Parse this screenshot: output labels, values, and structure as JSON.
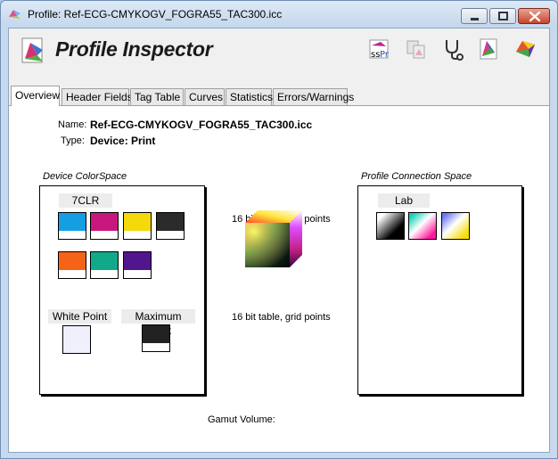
{
  "window": {
    "title": "Profile: Ref-ECG-CMYKOGV_FOGRA55_TAC300.icc"
  },
  "app": {
    "title": "Profile Inspector",
    "toolbar_icons": [
      "profile-compare-icon",
      "profile-copy-icon",
      "stethoscope-icon",
      "gamut-triangle-icon",
      "gamut-3d-icon"
    ]
  },
  "tabs": [
    {
      "label": "Overview",
      "active": true
    },
    {
      "label": "Header Fields",
      "active": false
    },
    {
      "label": "Tag Table",
      "active": false
    },
    {
      "label": "Curves",
      "active": false
    },
    {
      "label": "Statistics",
      "active": false
    },
    {
      "label": "Errors/Warnings",
      "active": false
    }
  ],
  "overview": {
    "name_label": "Name:",
    "name_value": "Ref-ECG-CMYKOGV_FOGRA55_TAC300.icc",
    "type_label": "Type:",
    "type_value": "Device: Print",
    "device_colorspace_label": "Device ColorSpace",
    "device_colorspace_name": "7CLR",
    "device_colors": [
      "#169ee2",
      "#c8187e",
      "#f4d90b",
      "#2b2b2b",
      "#f56416",
      "#12a98a",
      "#51168c"
    ],
    "white_point_label": "White Point",
    "white_point_color": "#eff0fc",
    "max_black_label": "Maximum Black",
    "max_black_color": "#222222",
    "a2b_table_text": "16 bit table,  grid points",
    "b2a_table_text": "16 bit table,  grid points",
    "pcs_label": "Profile Connection Space",
    "pcs_name": "Lab",
    "gamut_volume_label": "Gamut Volume:"
  }
}
